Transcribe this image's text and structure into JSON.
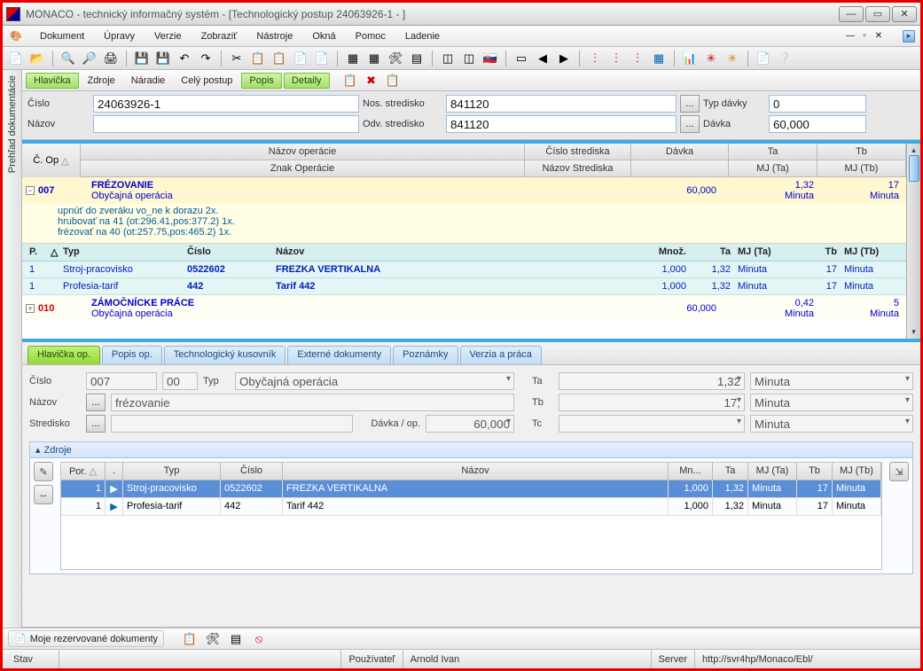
{
  "window": {
    "title": "MONACO - technický informačný systém - [Technologický postup 24063926-1 - ]"
  },
  "menu": {
    "items": [
      "Dokument",
      "Úpravy",
      "Verzie",
      "Zobraziť",
      "Nástroje",
      "Okná",
      "Pomoc",
      "Ladenie"
    ]
  },
  "sidebar": {
    "label": "Prehľad dokumentácie"
  },
  "doc_tabs": {
    "items": [
      "Hlavička",
      "Zdroje",
      "Náradie",
      "Celý postup",
      "Popis",
      "Detaily"
    ]
  },
  "header_form": {
    "cislo_label": "Číslo",
    "cislo_value": "24063926-1",
    "nazov_label": "Názov",
    "nazov_value": "",
    "nos_label": "Nos. stredisko",
    "nos_value": "841120",
    "odv_label": "Odv. stredisko",
    "odv_value": "841120",
    "typdavky_label": "Typ dávky",
    "typdavky_value": "0",
    "davka_label": "Dávka",
    "davka_value": "60,000"
  },
  "grid": {
    "headers": {
      "c_op": "Č. Op",
      "nazov_op": "Názov operácie",
      "znak_op": "Znak Operácie",
      "cislo_str": "Číslo strediska",
      "nazov_str": "Názov Strediska",
      "davka": "Dávka",
      "ta": "Ta",
      "mj_ta": "MJ (Ta)",
      "tb": "Tb",
      "mj_tb": "MJ (Tb)"
    },
    "op1": {
      "code": "007",
      "name": "FRÉZOVANIE",
      "type": "Obyčajná operácia",
      "davka": "60,000",
      "ta": "1,32",
      "mj_ta": "Minuta",
      "tb": "17",
      "mj_tb": "Minuta",
      "desc1": "upnúť do zveráku vo_ne k dorazu 2x.",
      "desc2": "hrubovať na 41 (ot:296.41,pos:377.2) 1x.",
      "desc3": "frézovať na 40 (ot:257.75,pos:465.2) 1x."
    },
    "res_head": {
      "p": "P.",
      "typ": "Typ",
      "cislo": "Číslo",
      "nazov": "Názov",
      "mnoz": "Množ.",
      "ta": "Ta",
      "mj_ta": "MJ (Ta)",
      "tb": "Tb",
      "mj_tb": "MJ (Tb)"
    },
    "res1": {
      "p": "1",
      "typ": "Stroj-pracovisko",
      "cislo": "0522602",
      "nazov": "FREZKA VERTIKALNA",
      "mnoz": "1,000",
      "ta": "1,32",
      "mj_ta": "Minuta",
      "tb": "17",
      "mj_tb": "Minuta"
    },
    "res2": {
      "p": "1",
      "typ": "Profesia-tarif",
      "cislo": "442",
      "nazov": "Tarif 442",
      "mnoz": "1,000",
      "ta": "1,32",
      "mj_ta": "Minuta",
      "tb": "17",
      "mj_tb": "Minuta"
    },
    "op2": {
      "code": "010",
      "name": "ZÁMOČNÍCKE PRÁCE",
      "type": "Obyčajná operácia",
      "davka": "60,000",
      "ta": "0,42",
      "mj_ta": "Minuta",
      "tb": "5",
      "mj_tb": "Minuta"
    }
  },
  "detail_tabs": {
    "items": [
      "Hlavička op.",
      "Popis op.",
      "Technologický kusovník",
      "Externé dokumenty",
      "Poznámky",
      "Verzia a práca"
    ]
  },
  "detail_form": {
    "cislo_l": "Číslo",
    "cislo_v": "007",
    "cislo_v2": "00",
    "typ_l": "Typ",
    "typ_v": "Obyčajná operácia",
    "nazov_l": "Názov",
    "nazov_v": "frézovanie",
    "stred_l": "Stredisko",
    "stred_v": "",
    "davka_l": "Dávka / op.",
    "davka_v": "60,000",
    "ta_l": "Ta",
    "ta_v": "1,32",
    "ta_u": "Minuta",
    "tb_l": "Tb",
    "tb_v": "17,",
    "tb_u": "Minuta",
    "tc_l": "Tc",
    "tc_v": "",
    "tc_u": "Minuta"
  },
  "zdroje": {
    "title": "Zdroje",
    "headers": {
      "por": "Por.",
      "dot": ".",
      "typ": "Typ",
      "cislo": "Číslo",
      "nazov": "Názov",
      "mn": "Mn...",
      "ta": "Ta",
      "mj_ta": "MJ (Ta)",
      "tb": "Tb",
      "mj_tb": "MJ (Tb)"
    },
    "row1": {
      "por": "1",
      "typ": "Stroj-pracovisko",
      "cislo": "0522602",
      "nazov": "FREZKA VERTIKALNA",
      "mn": "1,000",
      "ta": "1,32",
      "mj_ta": "Minuta",
      "tb": "17",
      "mj_tb": "Minuta"
    },
    "row2": {
      "por": "1",
      "typ": "Profesia-tarif",
      "cislo": "442",
      "nazov": "Tarif 442",
      "mn": "1,000",
      "ta": "1,32",
      "mj_ta": "Minuta",
      "tb": "17",
      "mj_tb": "Minuta"
    }
  },
  "bottom": {
    "reserved": "Moje rezervované dokumenty"
  },
  "status": {
    "stav_l": "Stav",
    "user_l": "Používateľ",
    "user_v": "Arnold Ivan",
    "server_l": "Server",
    "server_v": "http://svr4hp/Monaco/Ebl/"
  }
}
